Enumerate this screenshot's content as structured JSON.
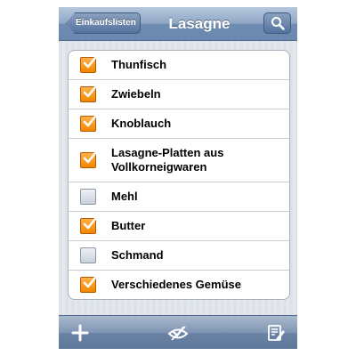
{
  "navbar": {
    "back_label": "Einkaufslisten",
    "title": "Lasagne"
  },
  "items": [
    {
      "label": "Thunfisch",
      "checked": true
    },
    {
      "label": "Zwiebeln",
      "checked": true
    },
    {
      "label": "Knoblauch",
      "checked": true
    },
    {
      "label": "Lasagne-Platten aus Vollkorneigwaren",
      "checked": true
    },
    {
      "label": "Mehl",
      "checked": false
    },
    {
      "label": "Butter",
      "checked": true
    },
    {
      "label": "Schmand",
      "checked": false
    },
    {
      "label": "Verschiedenes Gemüse",
      "checked": true
    }
  ],
  "toolbar": {
    "icons": [
      "plus-icon",
      "hide-checked-icon",
      "edit-list-icon"
    ]
  },
  "colors": {
    "navbar": "#7b95b8",
    "checked": "#f39a1f"
  }
}
